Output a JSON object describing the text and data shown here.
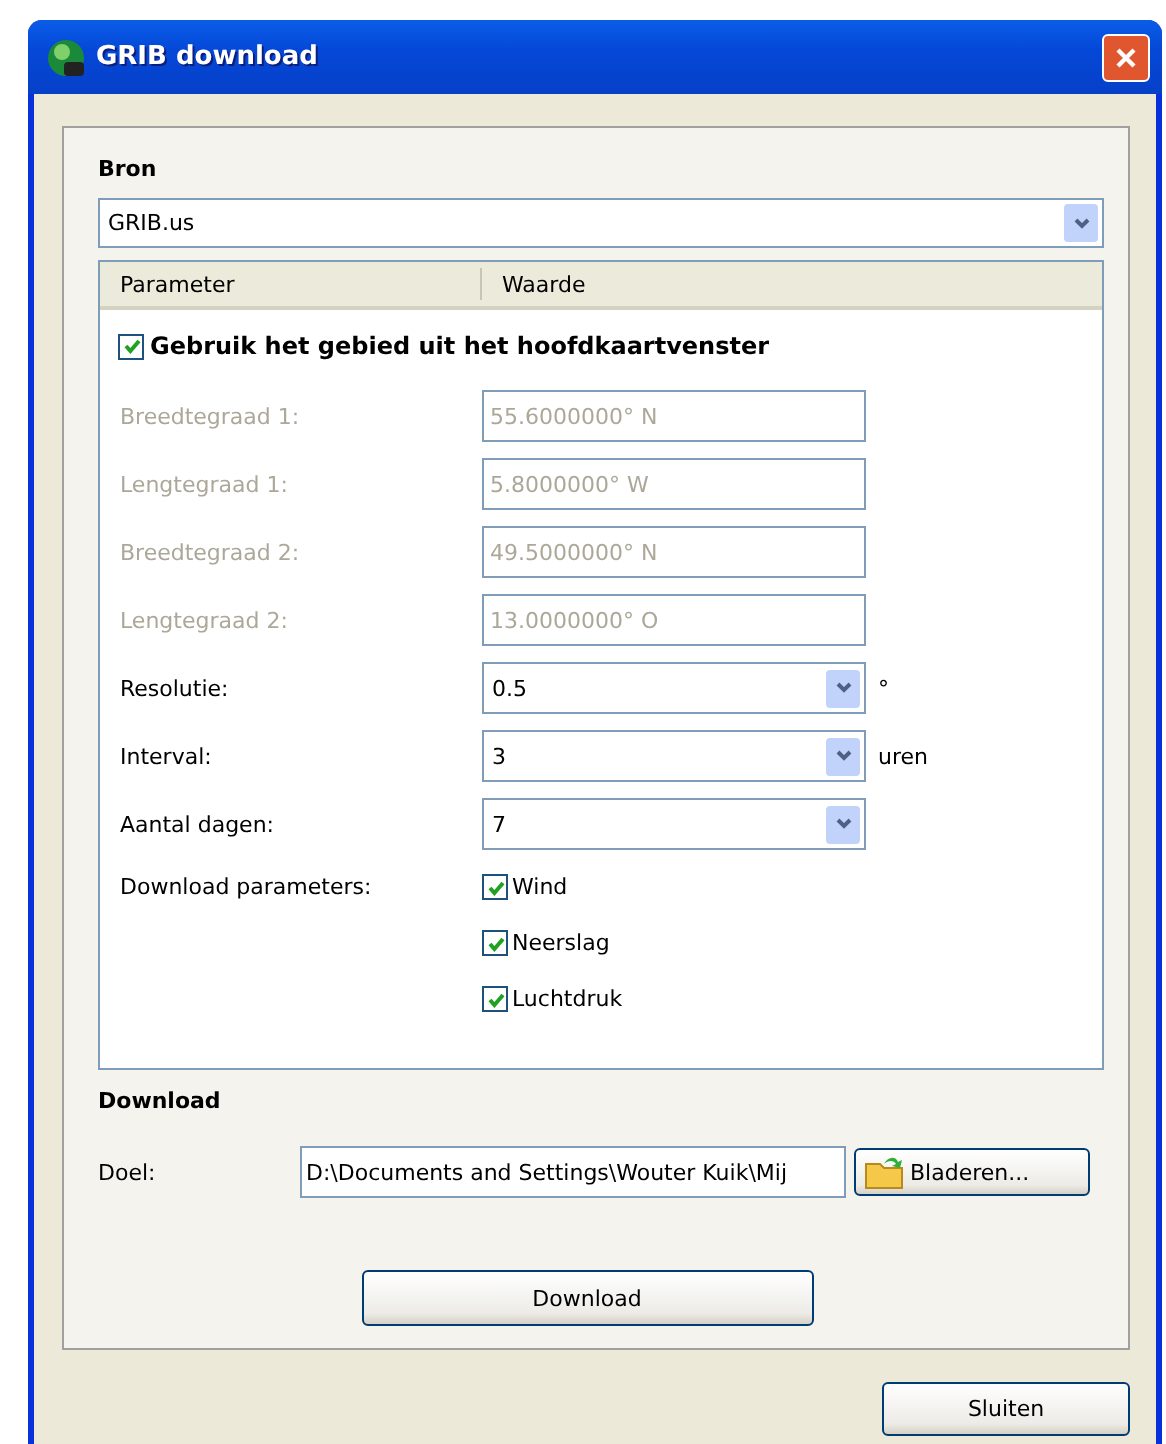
{
  "window": {
    "title": "GRIB download"
  },
  "source": {
    "heading": "Bron",
    "value": "GRIB.us"
  },
  "table": {
    "columns": [
      "Parameter",
      "Waarde"
    ],
    "use_map_area": {
      "label": "Gebruik het gebied uit het hoofdkaartvenster",
      "checked": true
    },
    "rows": [
      {
        "kind": "text",
        "label": "Breedtegraad 1:",
        "value": "55.6000000° N",
        "disabled": true
      },
      {
        "kind": "text",
        "label": "Lengtegraad 1:",
        "value": "5.8000000° W",
        "disabled": true
      },
      {
        "kind": "text",
        "label": "Breedtegraad 2:",
        "value": "49.5000000° N",
        "disabled": true
      },
      {
        "kind": "text",
        "label": "Lengtegraad 2:",
        "value": "13.0000000° O",
        "disabled": true
      },
      {
        "kind": "select",
        "label": "Resolutie:",
        "value": "0.5",
        "unit": "°"
      },
      {
        "kind": "select",
        "label": "Interval:",
        "value": "3",
        "unit": "uren"
      },
      {
        "kind": "select",
        "label": "Aantal dagen:",
        "value": "7"
      },
      {
        "kind": "checks",
        "label": "Download parameters:",
        "options": [
          {
            "label": "Wind",
            "checked": true
          },
          {
            "label": "Neerslag",
            "checked": true
          },
          {
            "label": "Luchtdruk",
            "checked": true
          }
        ]
      }
    ]
  },
  "download": {
    "heading": "Download",
    "target_label": "Doel:",
    "target_value": "D:\\Documents and Settings\\Wouter Kuik\\Mij",
    "browse_button": "Bladeren...",
    "download_button": "Download"
  },
  "close_button": "Sluiten"
}
